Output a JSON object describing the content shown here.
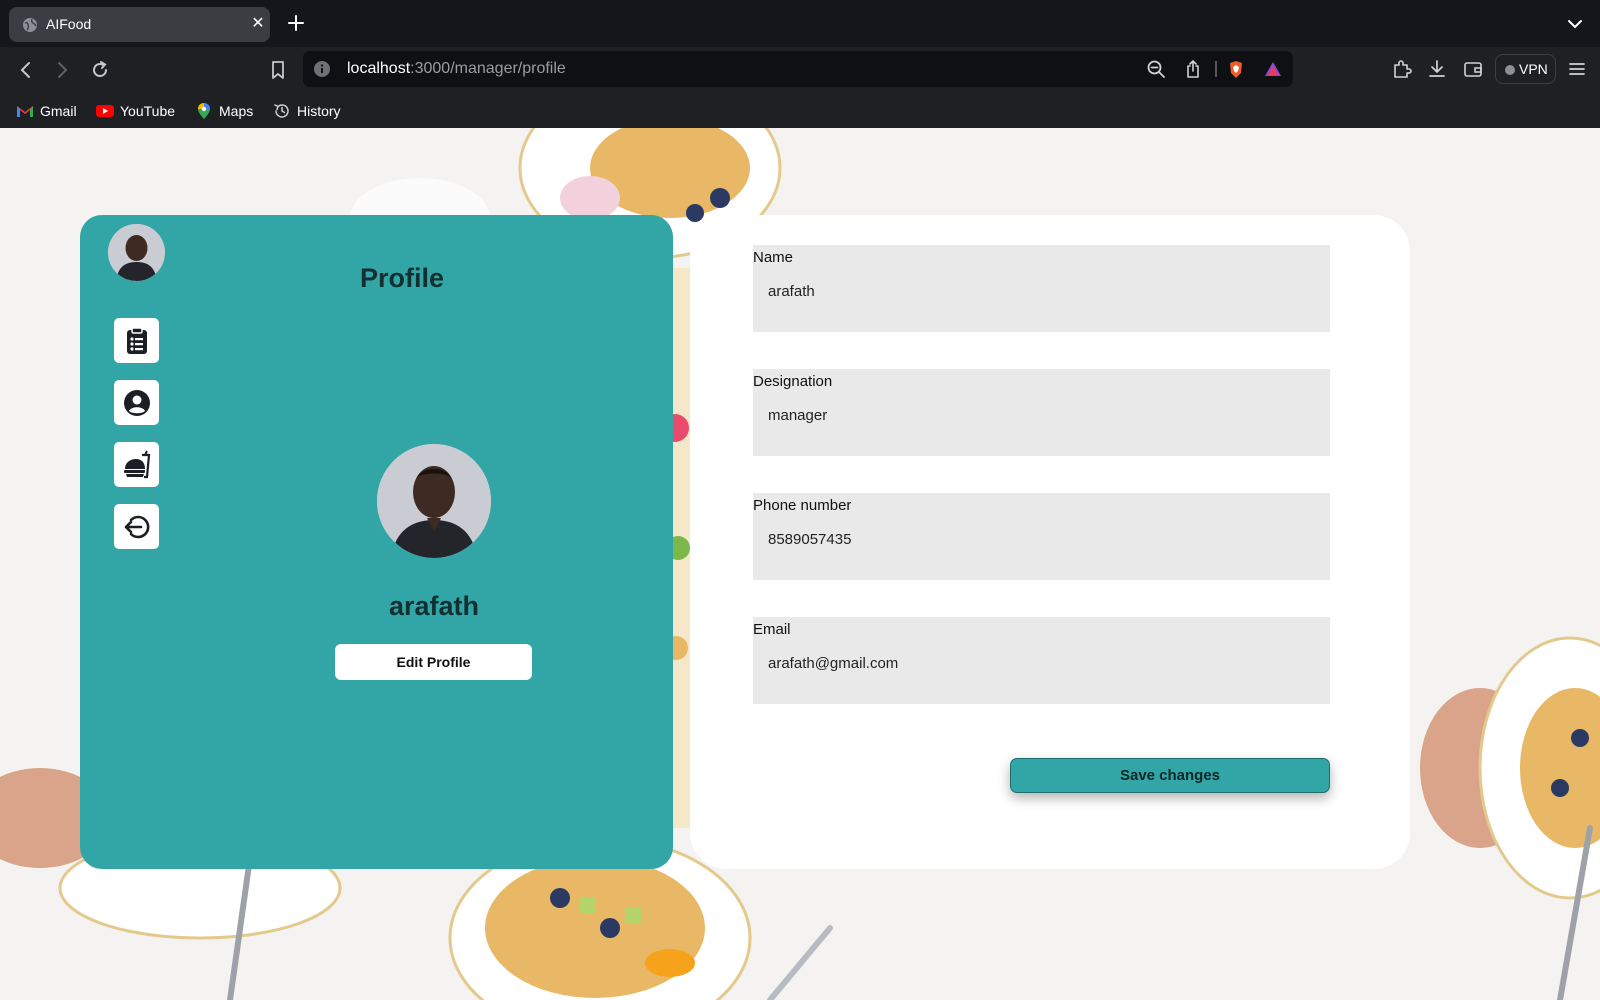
{
  "browser": {
    "tab_title": "AIFood",
    "tab_close": "✕",
    "url_host": "localhost",
    "url_path": ":3000/manager/profile",
    "vpn_label": "VPN",
    "bookmarks": [
      "Gmail",
      "YouTube",
      "Maps",
      "History"
    ]
  },
  "sidebar": {
    "items": [
      {
        "icon": "clipboard-list-icon"
      },
      {
        "icon": "user-circle-icon"
      },
      {
        "icon": "food-drink-icon"
      },
      {
        "icon": "logout-icon"
      }
    ]
  },
  "profile": {
    "title": "Profile",
    "name": "arafath",
    "edit_label": "Edit Profile"
  },
  "form": {
    "name_label": "Name",
    "name_value": "arafath",
    "designation_label": "Designation",
    "designation_value": "manager",
    "phone_label": "Phone number",
    "phone_value": "8589057435",
    "email_label": "Email",
    "email_value": "arafath@gmail.com",
    "save_label": "Save changes"
  },
  "colors": {
    "accent": "#32a6a6",
    "heading": "#123032",
    "field_bg": "#e9e9e9"
  }
}
